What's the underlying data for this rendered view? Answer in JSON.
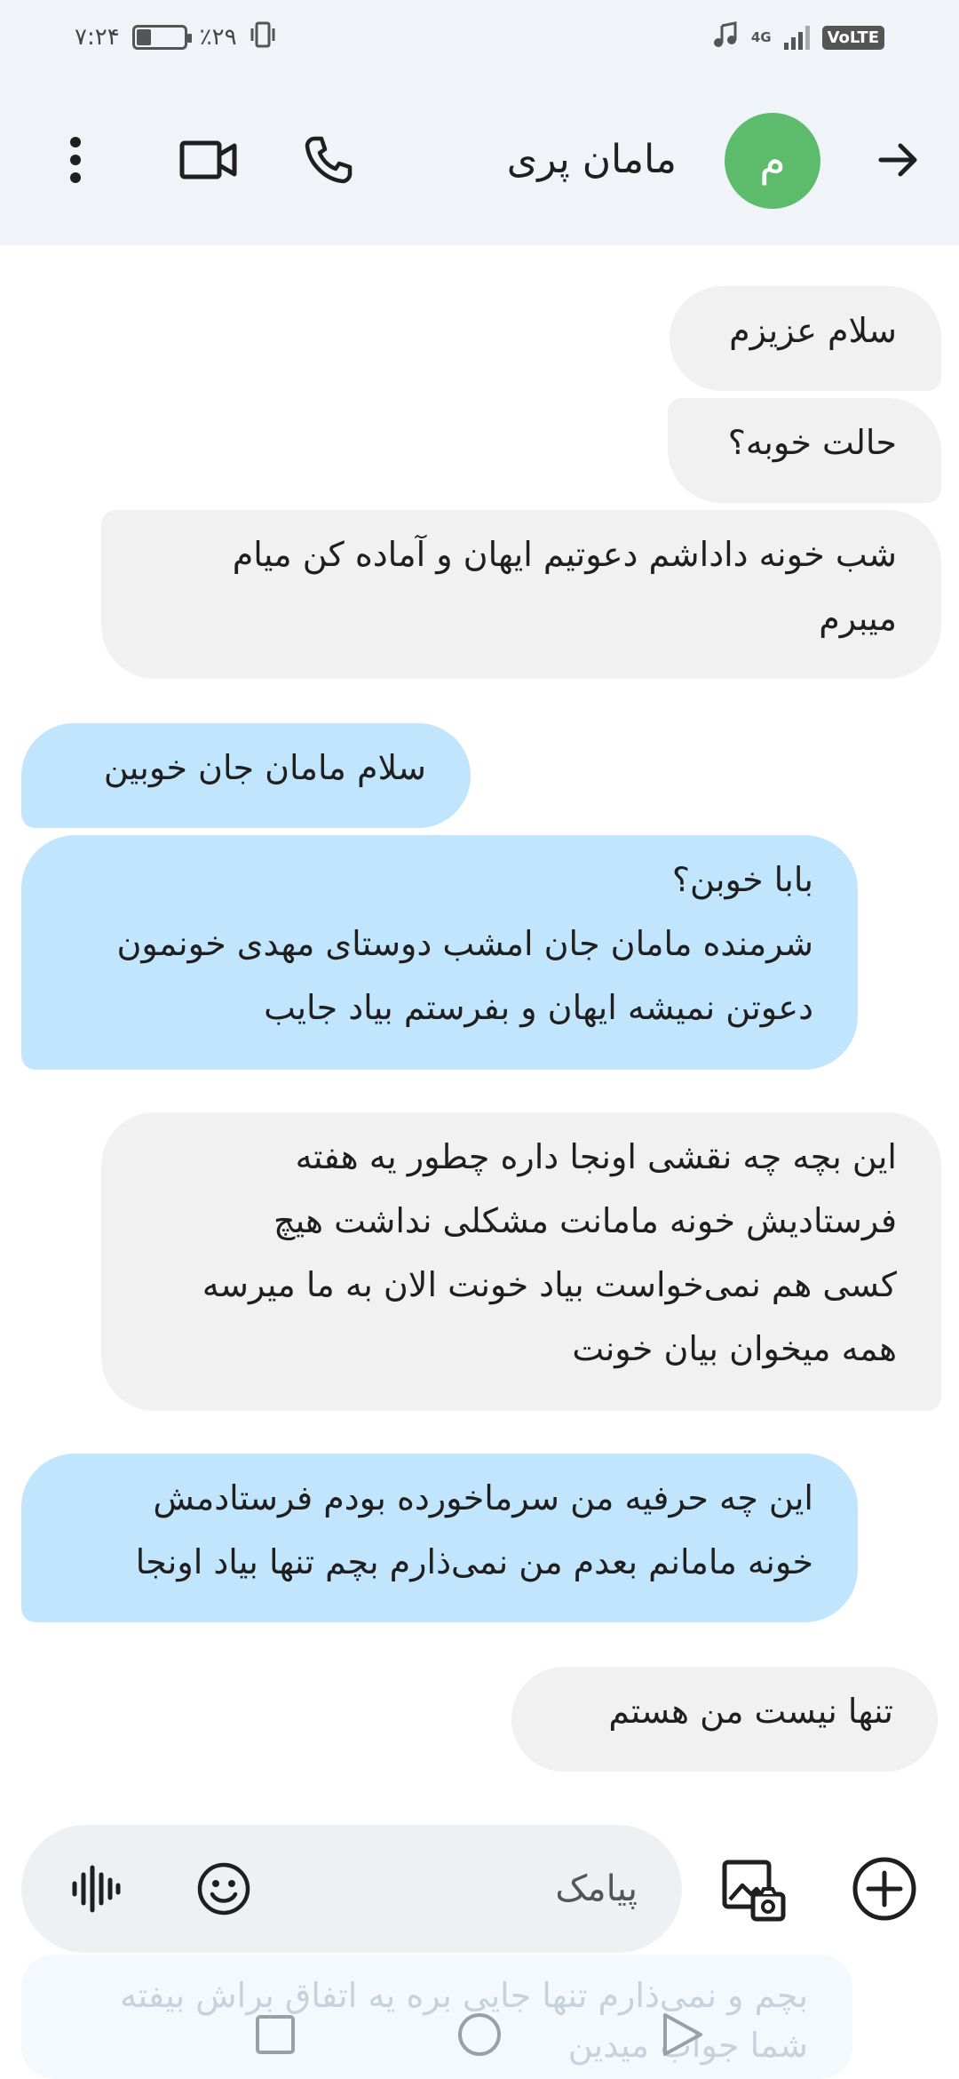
{
  "status_bar": {
    "time": "۷:۲۴",
    "battery_percent": "٪۲۹",
    "network_type": "4G",
    "volte": "VoLTE"
  },
  "header": {
    "contact_name": "مامان پری",
    "avatar_letter": "م",
    "avatar_color": "#5cbc6c"
  },
  "messages": [
    {
      "direction": "incoming",
      "lines": [
        "سلام عزیزم"
      ]
    },
    {
      "direction": "incoming",
      "lines": [
        "حالت خوبه؟"
      ]
    },
    {
      "direction": "incoming",
      "lines": [
        "شب خونه داداشم دعوتیم ایهان و آماده کن میام",
        "میبرم"
      ]
    },
    {
      "direction": "outgoing",
      "lines": [
        "سلام مامان جان خوبین"
      ]
    },
    {
      "direction": "outgoing",
      "lines": [
        "بابا خوبن؟",
        "شرمنده مامان جان امشب دوستای مهدی خونمون",
        "دعوتن نمیشه ایهان و بفرستم بیاد جایب"
      ]
    },
    {
      "direction": "incoming",
      "lines": [
        "این بچه چه نقشی اونجا داره چطور یه هفته",
        "فرستادیش خونه مامانت مشکلی نداشت هیچ",
        "کسی هم نمی‌خواست بیاد خونت الان به ما میرسه",
        "همه میخوان بیان خونت"
      ]
    },
    {
      "direction": "outgoing",
      "lines": [
        "این چه حرفیه من سرماخورده بودم فرستادمش",
        "خونه مامانم بعدم من نمی‌ذارم بچم تنها بیاد اونجا"
      ]
    },
    {
      "direction": "incoming",
      "lines": [
        "تنها نیست من هستم"
      ]
    }
  ],
  "composer": {
    "placeholder": "پیامک"
  },
  "draft_preview": {
    "lines": [
      "بچم و نمی‌ذارم تنها جایی بره یه اتفاق براش بیفته",
      "شما جواب میدین"
    ]
  },
  "colors": {
    "incoming_bubble": "#f1f1f1",
    "outgoing_bubble": "#c2e5fe",
    "header_bg": "#f0f3f8"
  },
  "icons": {
    "back": "arrow-right-icon",
    "call": "phone-icon",
    "video": "video-camera-icon",
    "more": "more-vert-icon",
    "emoji": "emoji-icon",
    "voice": "voice-wave-icon",
    "media": "gallery-add-icon",
    "add": "plus-circle-icon"
  }
}
